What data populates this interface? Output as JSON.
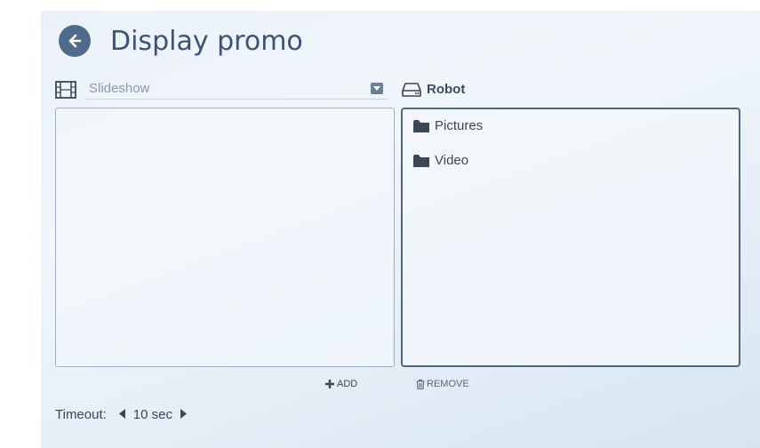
{
  "header": {
    "title": "Display promo",
    "back_icon": "arrow-left-icon",
    "accent": "#4f6b8c"
  },
  "source": {
    "select_value": "Slideshow",
    "icon": "film-icon"
  },
  "target": {
    "label": "Robot",
    "icon": "drive-icon"
  },
  "folders": [
    {
      "label": "Pictures",
      "icon": "folder-icon"
    },
    {
      "label": "Video",
      "icon": "folder-icon"
    }
  ],
  "actions": {
    "add": "ADD",
    "remove": "REMOVE"
  },
  "timeout": {
    "label": "Timeout:",
    "value": "10 sec"
  }
}
